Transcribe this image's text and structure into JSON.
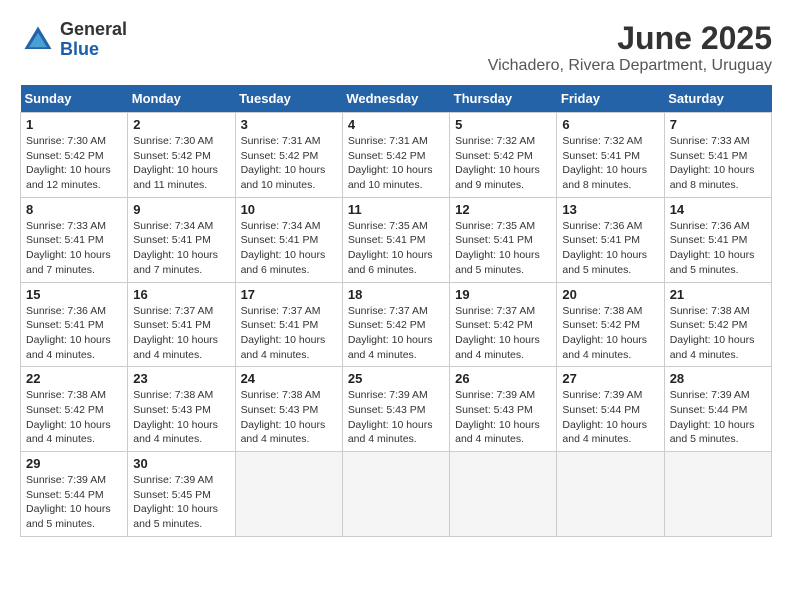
{
  "header": {
    "logo_general": "General",
    "logo_blue": "Blue",
    "month_title": "June 2025",
    "location": "Vichadero, Rivera Department, Uruguay"
  },
  "calendar": {
    "days_of_week": [
      "Sunday",
      "Monday",
      "Tuesday",
      "Wednesday",
      "Thursday",
      "Friday",
      "Saturday"
    ],
    "weeks": [
      [
        {
          "day": "1",
          "sunrise": "7:30 AM",
          "sunset": "5:42 PM",
          "daylight": "10 hours and 12 minutes."
        },
        {
          "day": "2",
          "sunrise": "7:30 AM",
          "sunset": "5:42 PM",
          "daylight": "10 hours and 11 minutes."
        },
        {
          "day": "3",
          "sunrise": "7:31 AM",
          "sunset": "5:42 PM",
          "daylight": "10 hours and 10 minutes."
        },
        {
          "day": "4",
          "sunrise": "7:31 AM",
          "sunset": "5:42 PM",
          "daylight": "10 hours and 10 minutes."
        },
        {
          "day": "5",
          "sunrise": "7:32 AM",
          "sunset": "5:42 PM",
          "daylight": "10 hours and 9 minutes."
        },
        {
          "day": "6",
          "sunrise": "7:32 AM",
          "sunset": "5:41 PM",
          "daylight": "10 hours and 8 minutes."
        },
        {
          "day": "7",
          "sunrise": "7:33 AM",
          "sunset": "5:41 PM",
          "daylight": "10 hours and 8 minutes."
        }
      ],
      [
        {
          "day": "8",
          "sunrise": "7:33 AM",
          "sunset": "5:41 PM",
          "daylight": "10 hours and 7 minutes."
        },
        {
          "day": "9",
          "sunrise": "7:34 AM",
          "sunset": "5:41 PM",
          "daylight": "10 hours and 7 minutes."
        },
        {
          "day": "10",
          "sunrise": "7:34 AM",
          "sunset": "5:41 PM",
          "daylight": "10 hours and 6 minutes."
        },
        {
          "day": "11",
          "sunrise": "7:35 AM",
          "sunset": "5:41 PM",
          "daylight": "10 hours and 6 minutes."
        },
        {
          "day": "12",
          "sunrise": "7:35 AM",
          "sunset": "5:41 PM",
          "daylight": "10 hours and 5 minutes."
        },
        {
          "day": "13",
          "sunrise": "7:36 AM",
          "sunset": "5:41 PM",
          "daylight": "10 hours and 5 minutes."
        },
        {
          "day": "14",
          "sunrise": "7:36 AM",
          "sunset": "5:41 PM",
          "daylight": "10 hours and 5 minutes."
        }
      ],
      [
        {
          "day": "15",
          "sunrise": "7:36 AM",
          "sunset": "5:41 PM",
          "daylight": "10 hours and 4 minutes."
        },
        {
          "day": "16",
          "sunrise": "7:37 AM",
          "sunset": "5:41 PM",
          "daylight": "10 hours and 4 minutes."
        },
        {
          "day": "17",
          "sunrise": "7:37 AM",
          "sunset": "5:41 PM",
          "daylight": "10 hours and 4 minutes."
        },
        {
          "day": "18",
          "sunrise": "7:37 AM",
          "sunset": "5:42 PM",
          "daylight": "10 hours and 4 minutes."
        },
        {
          "day": "19",
          "sunrise": "7:37 AM",
          "sunset": "5:42 PM",
          "daylight": "10 hours and 4 minutes."
        },
        {
          "day": "20",
          "sunrise": "7:38 AM",
          "sunset": "5:42 PM",
          "daylight": "10 hours and 4 minutes."
        },
        {
          "day": "21",
          "sunrise": "7:38 AM",
          "sunset": "5:42 PM",
          "daylight": "10 hours and 4 minutes."
        }
      ],
      [
        {
          "day": "22",
          "sunrise": "7:38 AM",
          "sunset": "5:42 PM",
          "daylight": "10 hours and 4 minutes."
        },
        {
          "day": "23",
          "sunrise": "7:38 AM",
          "sunset": "5:43 PM",
          "daylight": "10 hours and 4 minutes."
        },
        {
          "day": "24",
          "sunrise": "7:38 AM",
          "sunset": "5:43 PM",
          "daylight": "10 hours and 4 minutes."
        },
        {
          "day": "25",
          "sunrise": "7:39 AM",
          "sunset": "5:43 PM",
          "daylight": "10 hours and 4 minutes."
        },
        {
          "day": "26",
          "sunrise": "7:39 AM",
          "sunset": "5:43 PM",
          "daylight": "10 hours and 4 minutes."
        },
        {
          "day": "27",
          "sunrise": "7:39 AM",
          "sunset": "5:44 PM",
          "daylight": "10 hours and 4 minutes."
        },
        {
          "day": "28",
          "sunrise": "7:39 AM",
          "sunset": "5:44 PM",
          "daylight": "10 hours and 5 minutes."
        }
      ],
      [
        {
          "day": "29",
          "sunrise": "7:39 AM",
          "sunset": "5:44 PM",
          "daylight": "10 hours and 5 minutes."
        },
        {
          "day": "30",
          "sunrise": "7:39 AM",
          "sunset": "5:45 PM",
          "daylight": "10 hours and 5 minutes."
        },
        null,
        null,
        null,
        null,
        null
      ]
    ]
  }
}
